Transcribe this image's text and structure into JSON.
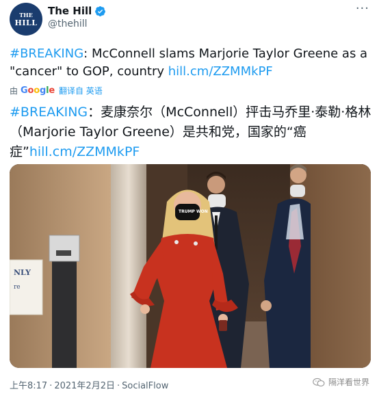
{
  "account": {
    "display_name": "The Hill",
    "handle": "@thehill",
    "avatar_text_top": "THE",
    "avatar_text_bottom": "HILL",
    "more_label": "···"
  },
  "tweet": {
    "hashtag": "#BREAKING",
    "text_en": ": McConnell slams Marjorie Taylor Greene as a \"cancer\" to GOP, country ",
    "link": "hill.cm/ZZMMkPF",
    "translate_prefix": "由",
    "translate_brand": "Google",
    "translate_label": "翻译自 英语",
    "hashtag_zh": "#BREAKING",
    "text_zh": "：麦康奈尔（McConnell）抨击马乔里·泰勒·格林（Marjorie Taylor Greene）是共和党，国家的“癌症”",
    "link_zh": "hill.cm/ZZMMkPF",
    "mask_text": "TRUMP WON"
  },
  "footer": {
    "time": "上午8:17",
    "separator": "·",
    "date": "2021年2月2日",
    "source": "SocialFlow"
  },
  "watermark": {
    "text": "隔洋看世界"
  },
  "colors": {
    "link": "#1d9bf0",
    "avatar_bg": "#1a3c6e",
    "verified": "#1d9bf0",
    "dress": "#c8321f"
  }
}
